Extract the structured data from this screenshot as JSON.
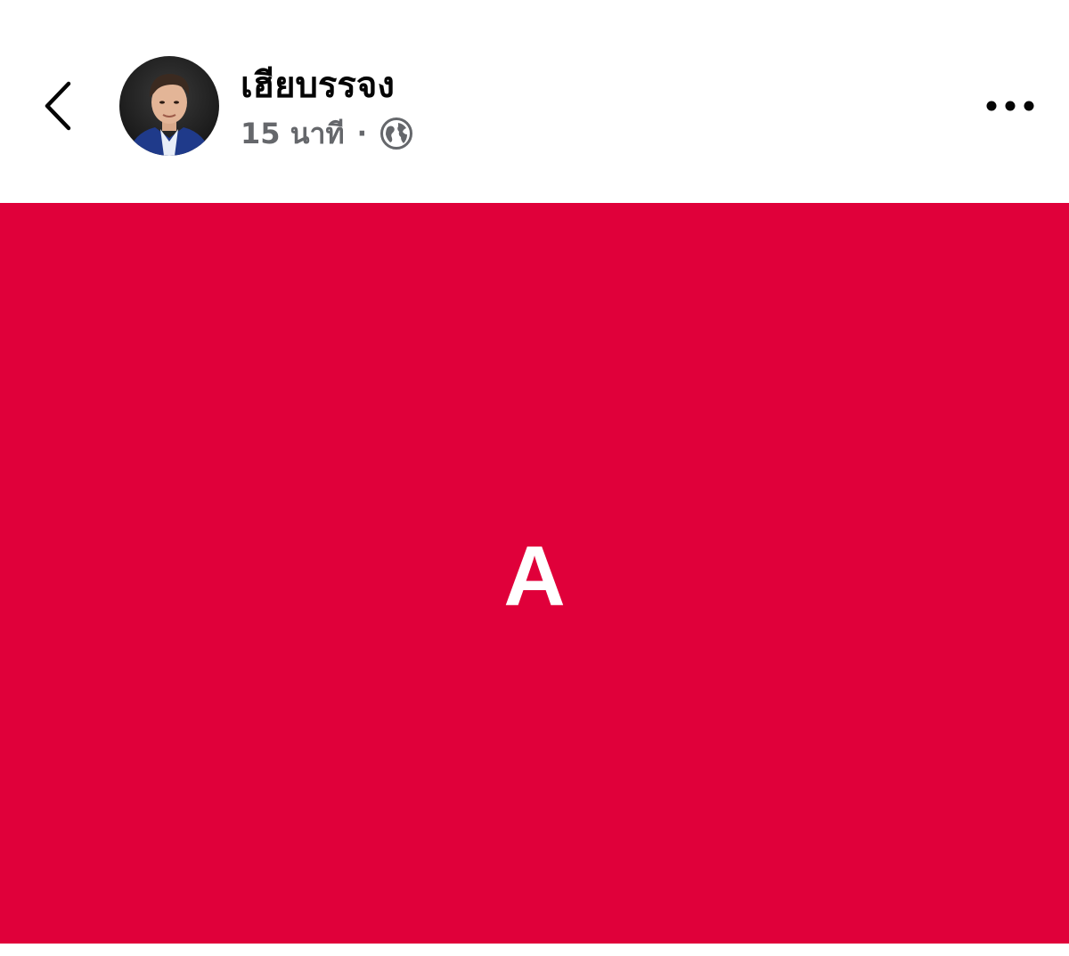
{
  "post": {
    "author_name": "เฮียบรรจง",
    "timestamp": "15 นาที",
    "separator": "·",
    "privacy_icon": "globe-icon",
    "image_text": "A",
    "image_background": "#e0003a"
  },
  "header": {
    "back_icon": "chevron-left-icon",
    "more_icon": "more-horizontal-icon"
  },
  "colors": {
    "name_text": "#050505",
    "meta_text": "#65676b",
    "accent_red": "#e0003a"
  }
}
